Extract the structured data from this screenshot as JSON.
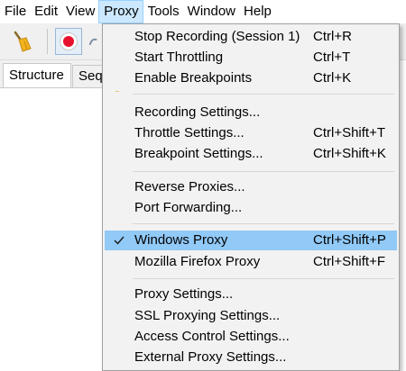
{
  "menubar": {
    "items": [
      "File",
      "Edit",
      "View",
      "Proxy",
      "Tools",
      "Window",
      "Help"
    ],
    "active": "Proxy"
  },
  "tabs": [
    "Structure",
    "Sequ"
  ],
  "proxy_menu": {
    "groups": [
      [
        {
          "label": "Stop Recording (Session 1)",
          "shortcut": "Ctrl+R"
        },
        {
          "label": "Start Throttling",
          "shortcut": "Ctrl+T"
        },
        {
          "label": "Enable Breakpoints",
          "shortcut": "Ctrl+K"
        }
      ],
      [
        {
          "label": "Recording Settings...",
          "shortcut": ""
        },
        {
          "label": "Throttle Settings...",
          "shortcut": "Ctrl+Shift+T"
        },
        {
          "label": "Breakpoint Settings...",
          "shortcut": "Ctrl+Shift+K"
        }
      ],
      [
        {
          "label": "Reverse Proxies...",
          "shortcut": ""
        },
        {
          "label": "Port Forwarding...",
          "shortcut": ""
        }
      ],
      [
        {
          "label": "Windows Proxy",
          "shortcut": "Ctrl+Shift+P",
          "checked": true,
          "highlighted": true
        },
        {
          "label": "Mozilla Firefox Proxy",
          "shortcut": "Ctrl+Shift+F"
        }
      ],
      [
        {
          "label": "Proxy Settings...",
          "shortcut": ""
        },
        {
          "label": "SSL Proxying Settings...",
          "shortcut": ""
        },
        {
          "label": "Access Control Settings...",
          "shortcut": ""
        },
        {
          "label": "External Proxy Settings...",
          "shortcut": ""
        }
      ]
    ]
  },
  "colors": {
    "highlight": "#91c9f7",
    "menubar_active": "#cce8ff",
    "record": "#e8112d"
  },
  "icons": [
    "broom-icon",
    "record-icon",
    "check-icon"
  ]
}
